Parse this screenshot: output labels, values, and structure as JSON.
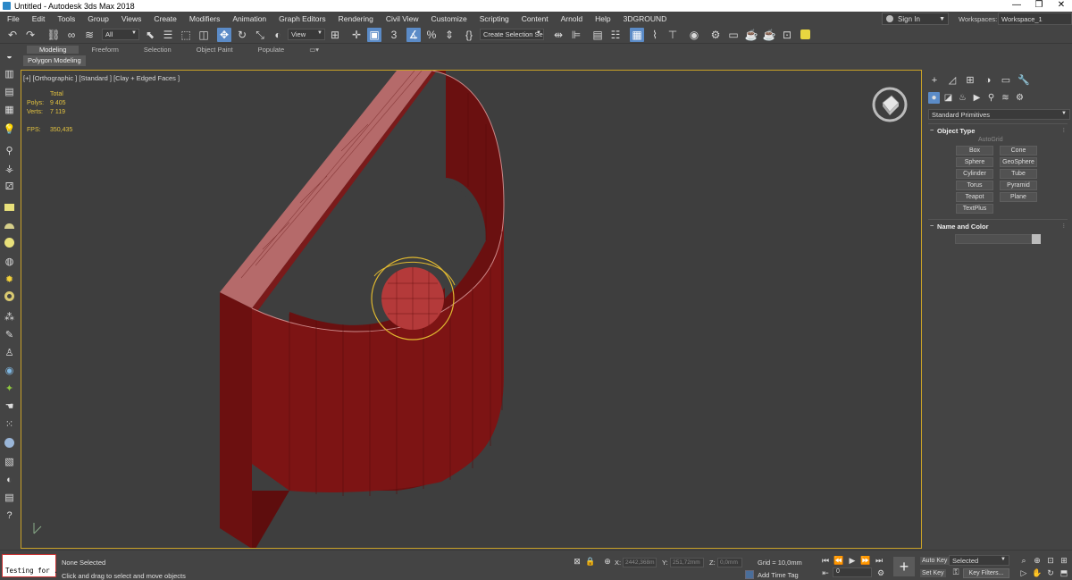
{
  "window": {
    "title": "Untitled - Autodesk 3ds Max 2018",
    "minimize": "—",
    "restore": "❐",
    "close": "✕"
  },
  "menu": [
    "File",
    "Edit",
    "Tools",
    "Group",
    "Views",
    "Create",
    "Modifiers",
    "Animation",
    "Graph Editors",
    "Rendering",
    "Civil View",
    "Customize",
    "Scripting",
    "Content",
    "Arnold",
    "Help",
    "3DGROUND"
  ],
  "account": {
    "sign_in": "Sign In",
    "workspaces_label": "Workspaces:",
    "workspace": "Workspace_1"
  },
  "toolbar": {
    "selection_filter": "All",
    "ref_coord": "View",
    "named_selection": "Create Selection Se"
  },
  "ribbon": {
    "tabs": [
      "Modeling",
      "Freeform",
      "Selection",
      "Object Paint",
      "Populate"
    ],
    "active_tab": "Modeling",
    "panel": "Polygon Modeling"
  },
  "viewport": {
    "label": "[+] [Orthographic ] [Standard ] [Clay + Edged Faces ]",
    "stats": {
      "header": "Total",
      "polys_label": "Polys:",
      "polys": "9 405",
      "verts_label": "Verts:",
      "verts": "7 119",
      "fps_label": "FPS:",
      "fps": "350,435"
    }
  },
  "command_panel": {
    "category": "Standard Primitives",
    "object_type_title": "Object Type",
    "autogrid": "AutoGrid",
    "buttons": [
      "Box",
      "Cone",
      "Sphere",
      "GeoSphere",
      "Cylinder",
      "Tube",
      "Torus",
      "Pyramid",
      "Teapot",
      "Plane",
      "TextPlus"
    ],
    "name_color_title": "Name and Color"
  },
  "status": {
    "maxscript": "Testing for .",
    "selection": "None Selected",
    "prompt": "Click and drag to select and move objects",
    "x_label": "X:",
    "x": "2442,368m",
    "y_label": "Y:",
    "y": "251,72mm",
    "z_label": "Z:",
    "z": "0,0mm",
    "grid": "Grid = 10,0mm",
    "add_time_tag": "Add Time Tag",
    "frame": "0",
    "auto_key": "Auto Key",
    "set_key": "Set Key",
    "key_mode": "Selected",
    "key_filters": "Key Filters..."
  },
  "colors": {
    "viewport_border": "#c9a227",
    "active_blue": "#5b8bc7",
    "model_red": "#7a1212",
    "stats_yellow": "#e2c240"
  }
}
